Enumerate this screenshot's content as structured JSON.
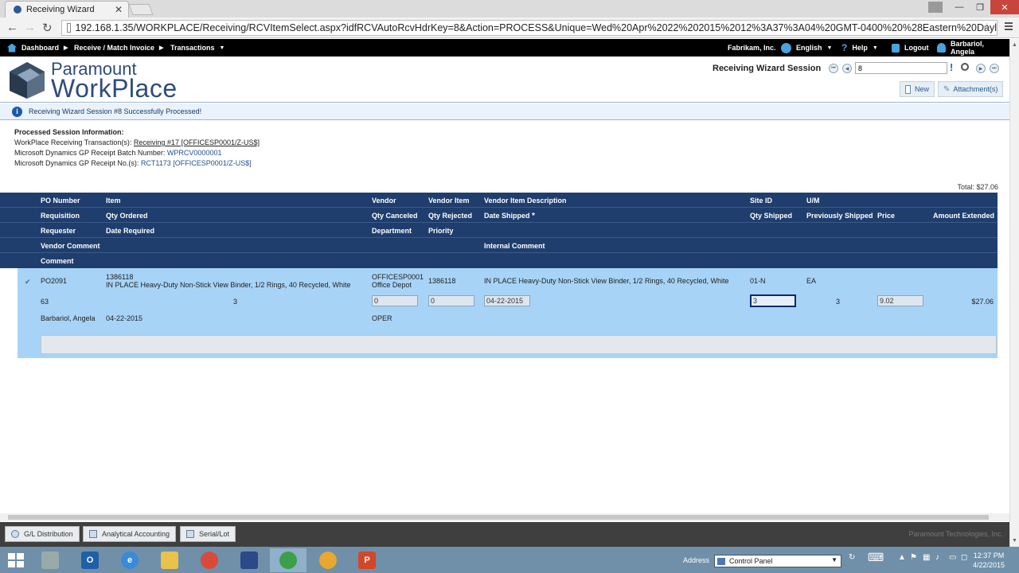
{
  "browser": {
    "tab_title": "Receiving Wizard",
    "url": "192.168.1.35/WORKPLACE/Receiving/RCVItemSelect.aspx?idfRCVAutoRcvHdrKey=8&Action=PROCESS&Unique=Wed%20Apr%2022%202015%2012%3A37%3A04%20GMT-0400%20%28Eastern%20Dayl"
  },
  "topnav": {
    "dashboard": "Dashboard",
    "receive_match": "Receive / Match Invoice",
    "transactions": "Transactions",
    "company": "Fabrikam, Inc.",
    "language": "English",
    "help": "Help",
    "logout": "Logout",
    "user": "Barbariol, Angela"
  },
  "logo": {
    "line1": "Paramount",
    "line2": "WorkPlace"
  },
  "session": {
    "title": "Receiving Wizard Session",
    "number": "8",
    "new_label": "New",
    "attachments_label": "Attachment(s)"
  },
  "info_message": "Receiving Wizard Session #8 Successfully Processed!",
  "processed": {
    "heading": "Processed Session Information:",
    "line1_label": "WorkPlace Receiving Transaction(s):",
    "line1_value": "Receiving #17 [OFFICESP0001/Z-US$]",
    "line2_label": "Microsoft Dynamics GP Receipt Batch Number:",
    "line2_value": "WPRCV0000001",
    "line3_label": "Microsoft Dynamics GP Receipt No.(s):",
    "line3_value": "RCT1173 [OFFICESP0001/Z-US$]"
  },
  "total": "Total: $27.06",
  "grid": {
    "headers": {
      "po_number": "PO Number",
      "item": "Item",
      "vendor": "Vendor",
      "vendor_item": "Vendor Item",
      "vendor_item_desc": "Vendor Item Description",
      "site_id": "Site ID",
      "um": "U/M",
      "requisition": "Requisition",
      "qty_ordered": "Qty Ordered",
      "qty_canceled": "Qty Canceled",
      "qty_rejected": "Qty Rejected",
      "date_shipped": "Date Shipped",
      "qty_shipped": "Qty Shipped",
      "previously_shipped": "Previously Shipped",
      "price": "Price",
      "amount_extended": "Amount Extended",
      "requester": "Requester",
      "date_required": "Date Required",
      "department": "Department",
      "priority": "Priority",
      "vendor_comment": "Vendor Comment",
      "internal_comment": "Internal Comment",
      "comment": "Comment"
    },
    "row": {
      "po_number": "PO2091",
      "item_code": "1386118",
      "item_desc": "IN PLACE Heavy-Duty Non-Stick View Binder, 1/2 Rings, 40 Recycled, White",
      "vendor_id": "OFFICESP0001",
      "vendor_name": "Office Depot",
      "vendor_item": "1386118",
      "vendor_item_desc": "IN PLACE Heavy-Duty Non-Stick View Binder, 1/2 Rings, 40 Recycled, White",
      "site_id": "01-N",
      "um": "EA",
      "requisition": "63",
      "qty_ordered": "3",
      "qty_canceled": "0",
      "qty_rejected": "0",
      "date_shipped": "04-22-2015",
      "qty_shipped": "3",
      "previously_shipped": "3",
      "price": "9.02",
      "amount_extended": "$27.06",
      "requester": "Barbariol, Angela",
      "date_required": "04-22-2015",
      "department": "OPER"
    }
  },
  "bottom_buttons": {
    "gl": "G/L Distribution",
    "analytical": "Analytical Accounting",
    "serial": "Serial/Lot"
  },
  "copyright": "Paramount Technologies, Inc.",
  "taskbar": {
    "address_label": "Address",
    "address_value": "Control Panel",
    "time": "12:37 PM",
    "date": "4/22/2015"
  }
}
